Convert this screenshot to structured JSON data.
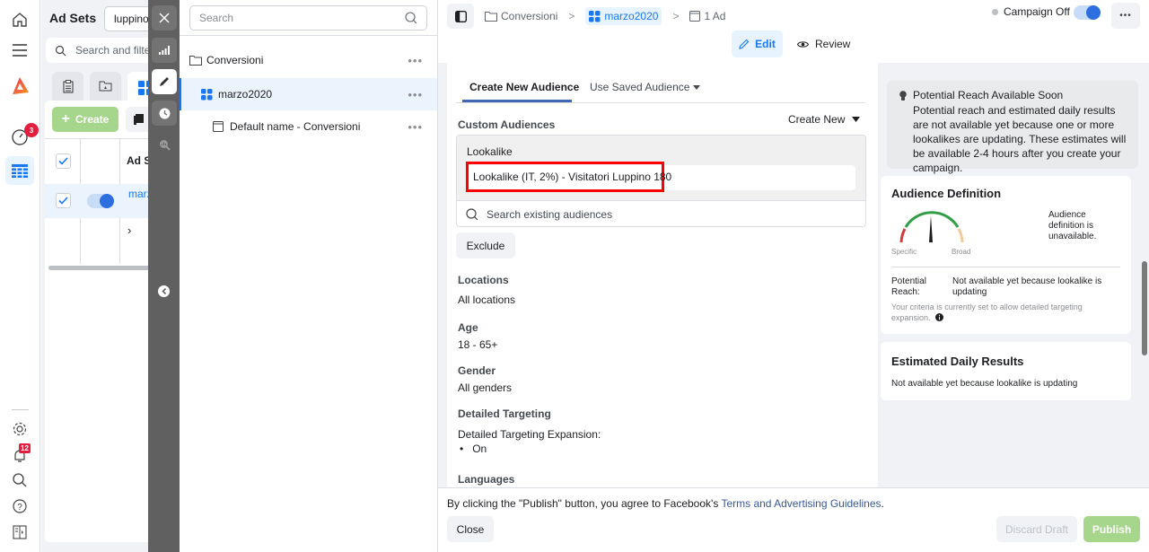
{
  "rail": {
    "notifications_badge": "3",
    "alerts_badge": "12"
  },
  "background": {
    "title": "Ad Sets",
    "account_field": "luppino",
    "search_placeholder": "Search and filter",
    "create_label": "Create",
    "column_header": "Ad S",
    "row_name": "marz"
  },
  "tree": {
    "search_placeholder": "Search",
    "items": [
      {
        "label": "Conversioni",
        "icon": "folder-icon",
        "level": 0
      },
      {
        "label": "marzo2020",
        "icon": "adset-grid-icon",
        "level": 1,
        "selected": true
      },
      {
        "label": "Default name - Conversioni",
        "icon": "ad-icon",
        "level": 2
      }
    ],
    "more_label": "•••"
  },
  "topbar": {
    "breadcrumb": [
      {
        "label": "Conversioni",
        "icon": "folder-icon"
      },
      {
        "label": "marzo2020",
        "icon": "adset-grid-icon",
        "active": true
      },
      {
        "label": "1 Ad",
        "icon": "ad-icon"
      }
    ],
    "separator": ">",
    "campaign_status": "Campaign Off",
    "toggle_on": true,
    "more_label": "•••",
    "edit_label": "Edit",
    "review_label": "Review"
  },
  "editor": {
    "tabs": [
      {
        "label": "Create New Audience",
        "active": true
      },
      {
        "label": "Use Saved Audience",
        "dropdown": true
      }
    ],
    "custom_audiences_label": "Custom Audiences",
    "create_new_label": "Create New",
    "lookalike_header": "Lookalike",
    "lookalike_value": "Lookalike (IT, 2%) - Visitatori Luppino 180",
    "search_placeholder": "Search existing audiences",
    "exclude_label": "Exclude",
    "sections": [
      {
        "label": "Locations",
        "value": "All locations"
      },
      {
        "label": "Age",
        "value": "18 - 65+"
      },
      {
        "label": "Gender",
        "value": "All genders"
      }
    ],
    "detailed_targeting_label": "Detailed Targeting",
    "expansion_label": "Detailed Targeting Expansion:",
    "expansion_value": "On",
    "languages_label": "Languages"
  },
  "side": {
    "notice_title": "Potential Reach Available Soon",
    "notice_body": "Potential reach and estimated daily results are not available yet because one or more lookalikes are updating. These estimates will be available 2-4 hours after you create your campaign.",
    "audience_title": "Audience Definition",
    "gauge_left": "Specific",
    "gauge_right": "Broad",
    "audience_status": "Audience definition is unavailable.",
    "reach_label": "Potential Reach:",
    "reach_value": "Not available yet because lookalike is updating",
    "criteria_note": "Your criteria is currently set to allow detailed targeting expansion.",
    "daily_title": "Estimated Daily Results",
    "daily_value": "Not available yet because lookalike is updating"
  },
  "footer": {
    "agreement_prefix": "By clicking the \"Publish\" button, you agree to Facebook's ",
    "agreement_link": "Terms and Advertising Guidelines",
    "agreement_suffix": ".",
    "close_label": "Close",
    "discard_label": "Discard Draft",
    "publish_label": "Publish"
  },
  "colors": {
    "accent": "#1877f2",
    "publish_disabled": "#a5d68b",
    "highlight_box": "#ff0000",
    "strip": "#606060"
  }
}
